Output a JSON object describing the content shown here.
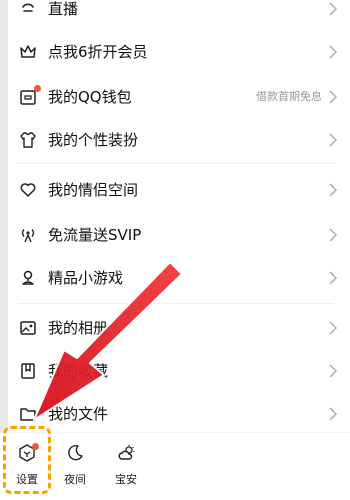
{
  "menu": {
    "items": [
      {
        "label": "直播",
        "icon": "live-broadcast-icon"
      },
      {
        "label": "点我6折开会员",
        "icon": "crown-icon"
      },
      {
        "label": "我的QQ钱包",
        "icon": "wallet-icon",
        "hint": "借款首期免息",
        "badge_dot": true
      },
      {
        "label": "我的个性装扮",
        "icon": "tshirt-icon"
      },
      {
        "label": "我的情侣空间",
        "icon": "heart-icon"
      },
      {
        "label": "免流量送SVIP",
        "icon": "antenna-icon"
      },
      {
        "label": "精品小游戏",
        "icon": "game-pin-icon"
      },
      {
        "label": "我的相册",
        "icon": "photo-album-icon"
      },
      {
        "label": "我的收藏",
        "icon": "bookmark-icon"
      },
      {
        "label": "我的文件",
        "icon": "folder-icon"
      }
    ]
  },
  "bottom_bar": {
    "settings": {
      "label": "设置",
      "icon": "settings-hexagon-icon",
      "badge_dot": true
    },
    "night": {
      "label": "夜间",
      "icon": "moon-icon"
    },
    "guard": {
      "label": "宝安",
      "icon": "weather-sun-cloud-icon"
    }
  },
  "colors": {
    "accent_red": "#f5543e",
    "annotation_arrow": "#e8202a",
    "annotation_box": "#f5a300",
    "hint_text": "#9a9a9a"
  }
}
